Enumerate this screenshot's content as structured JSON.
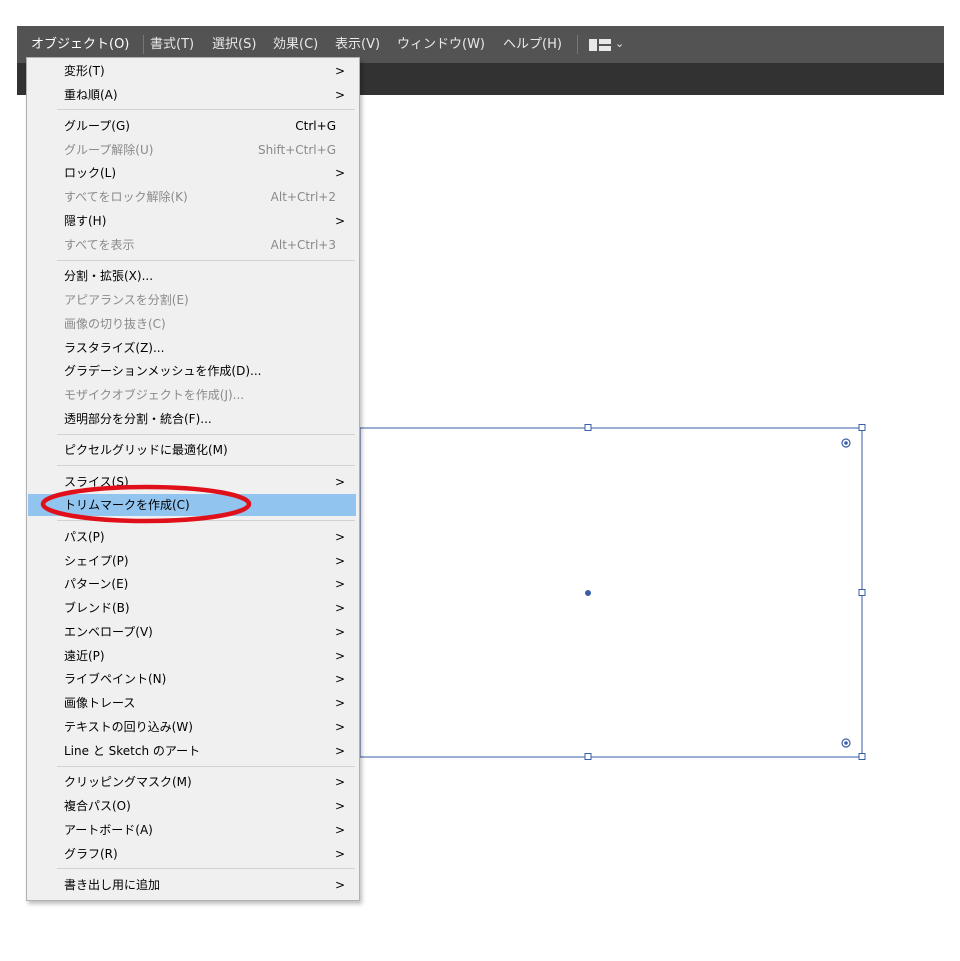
{
  "menubar": {
    "items": [
      {
        "label": "オブジェクト(O)"
      },
      {
        "label": "書式(T)"
      },
      {
        "label": "選択(S)"
      },
      {
        "label": "効果(C)"
      },
      {
        "label": "表示(V)"
      },
      {
        "label": "ウィンドウ(W)"
      },
      {
        "label": "ヘルプ(H)"
      }
    ]
  },
  "menu": {
    "items": [
      {
        "label": "変形(T)",
        "shortcut": "",
        "submenu": ">"
      },
      {
        "label": "重ね順(A)",
        "shortcut": "",
        "submenu": ">"
      },
      {
        "label": "グループ(G)",
        "shortcut": "Ctrl+G",
        "submenu": ""
      },
      {
        "label": "グループ解除(U)",
        "shortcut": "Shift+Ctrl+G",
        "submenu": ""
      },
      {
        "label": "ロック(L)",
        "shortcut": "",
        "submenu": ">"
      },
      {
        "label": "すべてをロック解除(K)",
        "shortcut": "Alt+Ctrl+2",
        "submenu": ""
      },
      {
        "label": "隠す(H)",
        "shortcut": "",
        "submenu": ">"
      },
      {
        "label": "すべてを表示",
        "shortcut": "Alt+Ctrl+3",
        "submenu": ""
      },
      {
        "label": "分割・拡張(X)...",
        "shortcut": "",
        "submenu": ""
      },
      {
        "label": "アピアランスを分割(E)",
        "shortcut": "",
        "submenu": ""
      },
      {
        "label": "画像の切り抜き(C)",
        "shortcut": "",
        "submenu": ""
      },
      {
        "label": "ラスタライズ(Z)...",
        "shortcut": "",
        "submenu": ""
      },
      {
        "label": "グラデーションメッシュを作成(D)...",
        "shortcut": "",
        "submenu": ""
      },
      {
        "label": "モザイクオブジェクトを作成(J)...",
        "shortcut": "",
        "submenu": ""
      },
      {
        "label": "透明部分を分割・統合(F)...",
        "shortcut": "",
        "submenu": ""
      },
      {
        "label": "ピクセルグリッドに最適化(M)",
        "shortcut": "",
        "submenu": ""
      },
      {
        "label": "スライス(S)",
        "shortcut": "",
        "submenu": ">"
      },
      {
        "label": "トリムマークを作成(C)",
        "shortcut": "",
        "submenu": ""
      },
      {
        "label": "パス(P)",
        "shortcut": "",
        "submenu": ">"
      },
      {
        "label": "シェイプ(P)",
        "shortcut": "",
        "submenu": ">"
      },
      {
        "label": "パターン(E)",
        "shortcut": "",
        "submenu": ">"
      },
      {
        "label": "ブレンド(B)",
        "shortcut": "",
        "submenu": ">"
      },
      {
        "label": "エンベロープ(V)",
        "shortcut": "",
        "submenu": ">"
      },
      {
        "label": "遠近(P)",
        "shortcut": "",
        "submenu": ">"
      },
      {
        "label": "ライブペイント(N)",
        "shortcut": "",
        "submenu": ">"
      },
      {
        "label": "画像トレース",
        "shortcut": "",
        "submenu": ">"
      },
      {
        "label": "テキストの回り込み(W)",
        "shortcut": "",
        "submenu": ">"
      },
      {
        "label": "Line と Sketch のアート",
        "shortcut": "",
        "submenu": ">"
      },
      {
        "label": "クリッピングマスク(M)",
        "shortcut": "",
        "submenu": ">"
      },
      {
        "label": "複合パス(O)",
        "shortcut": "",
        "submenu": ">"
      },
      {
        "label": "アートボード(A)",
        "shortcut": "",
        "submenu": ">"
      },
      {
        "label": "グラフ(R)",
        "shortcut": "",
        "submenu": ">"
      },
      {
        "label": "書き出し用に追加",
        "shortcut": "",
        "submenu": ">"
      }
    ]
  },
  "colors": {
    "menubar_bg": "#535353",
    "tabbar_bg": "#323232",
    "menu_bg": "#f0f0f0",
    "highlight": "#91c4ee",
    "selection": "#3b5ea8",
    "annotation": "#e0101a"
  }
}
